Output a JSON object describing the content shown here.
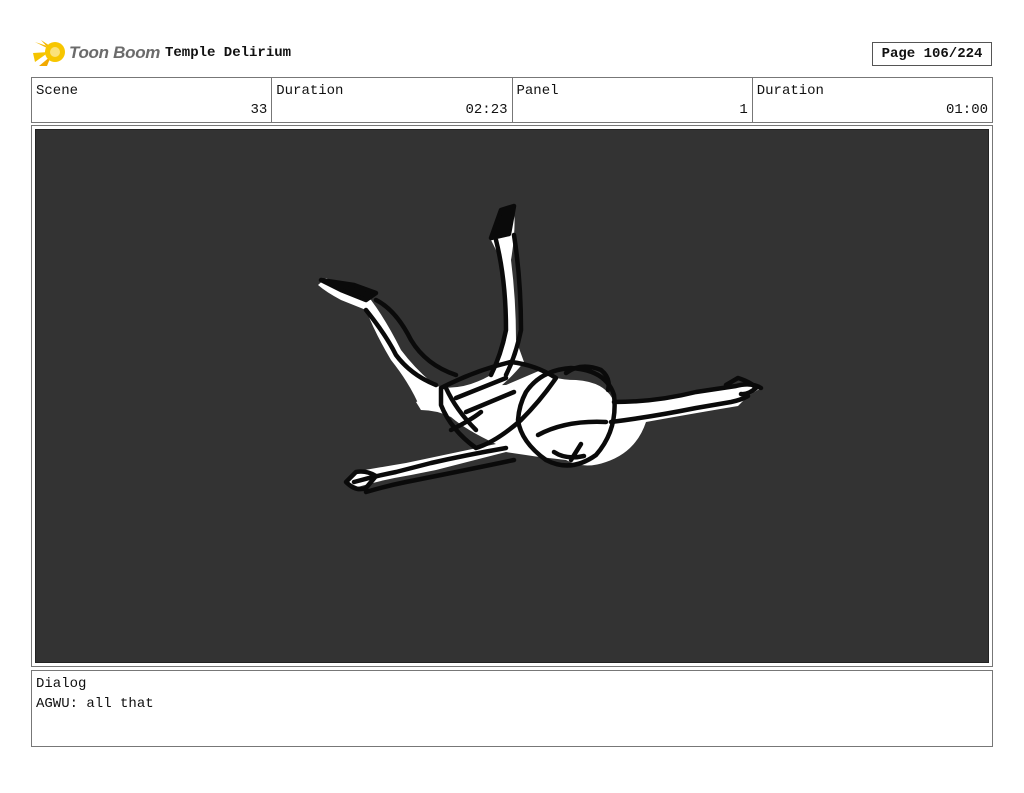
{
  "header": {
    "logo_text": "Toon Boom",
    "project_title": "Temple Delirium",
    "page_label": "Page 106/224"
  },
  "info": {
    "scene_label": "Scene",
    "scene_value": "33",
    "scene_duration_label": "Duration",
    "scene_duration_value": "02:23",
    "panel_label": "Panel",
    "panel_value": "1",
    "panel_duration_label": "Duration",
    "panel_duration_value": "01:00"
  },
  "panel": {
    "background_color": "#333333"
  },
  "dialog": {
    "label": "Dialog",
    "text": "AGWU: all that"
  }
}
